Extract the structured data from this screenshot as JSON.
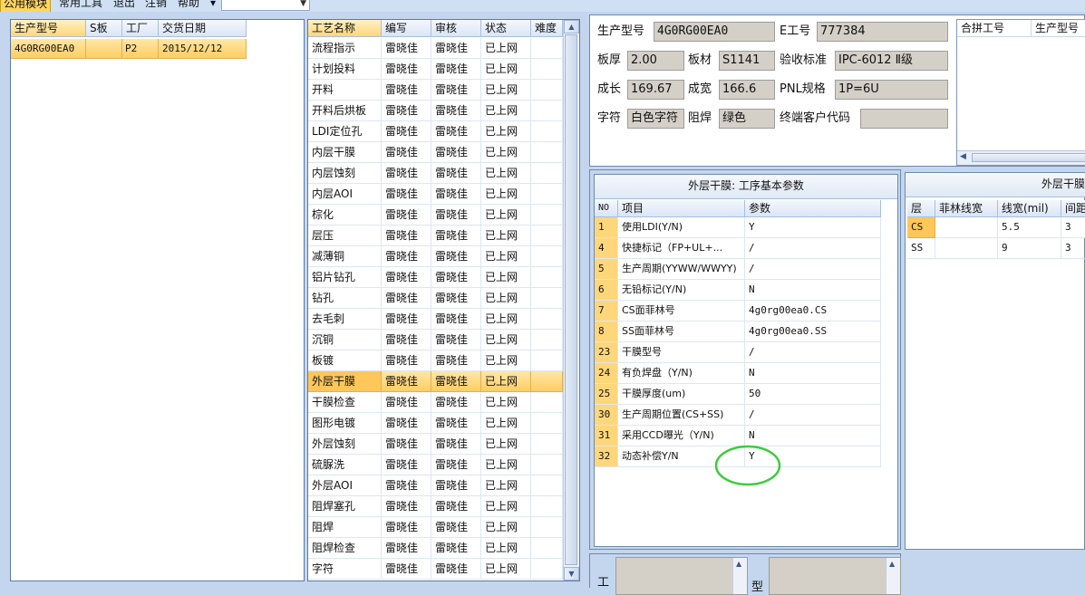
{
  "menu": {
    "items": [
      "公用模块",
      "常用工具",
      "退出",
      "注销",
      "帮助"
    ],
    "active_index": 0
  },
  "orders": {
    "columns": [
      "生产型号",
      "S板",
      "工厂",
      "交货日期"
    ],
    "rows": [
      {
        "model": "4G0RG00EA0",
        "s": "",
        "factory": "P2",
        "date": "2015/12/12"
      }
    ]
  },
  "process": {
    "columns": [
      "工艺名称",
      "编写",
      "审核",
      "状态",
      "难度"
    ],
    "selected_index": 17,
    "rows": [
      {
        "name": "流程指示",
        "writer": "雷晓佳",
        "reviewer": "雷晓佳",
        "status": "已上网"
      },
      {
        "name": "计划投料",
        "writer": "雷晓佳",
        "reviewer": "雷晓佳",
        "status": "已上网"
      },
      {
        "name": "开料",
        "writer": "雷晓佳",
        "reviewer": "雷晓佳",
        "status": "已上网"
      },
      {
        "name": "开料后烘板",
        "writer": "雷晓佳",
        "reviewer": "雷晓佳",
        "status": "已上网"
      },
      {
        "name": "LDI定位孔",
        "writer": "雷晓佳",
        "reviewer": "雷晓佳",
        "status": "已上网"
      },
      {
        "name": "内层干膜",
        "writer": "雷晓佳",
        "reviewer": "雷晓佳",
        "status": "已上网"
      },
      {
        "name": "内层蚀刻",
        "writer": "雷晓佳",
        "reviewer": "雷晓佳",
        "status": "已上网"
      },
      {
        "name": "内层AOI",
        "writer": "雷晓佳",
        "reviewer": "雷晓佳",
        "status": "已上网"
      },
      {
        "name": "棕化",
        "writer": "雷晓佳",
        "reviewer": "雷晓佳",
        "status": "已上网"
      },
      {
        "name": "层压",
        "writer": "雷晓佳",
        "reviewer": "雷晓佳",
        "status": "已上网"
      },
      {
        "name": "减薄铜",
        "writer": "雷晓佳",
        "reviewer": "雷晓佳",
        "status": "已上网"
      },
      {
        "name": "铝片钻孔",
        "writer": "雷晓佳",
        "reviewer": "雷晓佳",
        "status": "已上网"
      },
      {
        "name": "钻孔",
        "writer": "雷晓佳",
        "reviewer": "雷晓佳",
        "status": "已上网"
      },
      {
        "name": "去毛刺",
        "writer": "雷晓佳",
        "reviewer": "雷晓佳",
        "status": "已上网"
      },
      {
        "name": "沉铜",
        "writer": "雷晓佳",
        "reviewer": "雷晓佳",
        "status": "已上网"
      },
      {
        "name": "板镀",
        "writer": "雷晓佳",
        "reviewer": "雷晓佳",
        "status": "已上网"
      },
      {
        "name": "外层干膜",
        "writer": "雷晓佳",
        "reviewer": "雷晓佳",
        "status": "已上网"
      },
      {
        "name": "干膜检查",
        "writer": "雷晓佳",
        "reviewer": "雷晓佳",
        "status": "已上网"
      },
      {
        "name": "图形电镀",
        "writer": "雷晓佳",
        "reviewer": "雷晓佳",
        "status": "已上网"
      },
      {
        "name": "外层蚀刻",
        "writer": "雷晓佳",
        "reviewer": "雷晓佳",
        "status": "已上网"
      },
      {
        "name": "硫脲洗",
        "writer": "雷晓佳",
        "reviewer": "雷晓佳",
        "status": "已上网"
      },
      {
        "name": "外层AOI",
        "writer": "雷晓佳",
        "reviewer": "雷晓佳",
        "status": "已上网"
      },
      {
        "name": "阻焊塞孔",
        "writer": "雷晓佳",
        "reviewer": "雷晓佳",
        "status": "已上网"
      },
      {
        "name": "阻焊",
        "writer": "雷晓佳",
        "reviewer": "雷晓佳",
        "status": "已上网"
      },
      {
        "name": "阻焊检查",
        "writer": "雷晓佳",
        "reviewer": "雷晓佳",
        "status": "已上网"
      },
      {
        "name": "字符",
        "writer": "雷晓佳",
        "reviewer": "雷晓佳",
        "status": "已上网"
      }
    ]
  },
  "info": {
    "model_label": "生产型号",
    "model_value": "4G0RG00EA0",
    "eno_label": "E工号",
    "eno_value": "777384",
    "thickness_label": "板厚",
    "thickness_value": "2.00",
    "material_label": "板材",
    "material_value": "S1141",
    "standard_label": "验收标准",
    "standard_value": "IPC-6012 Ⅱ级",
    "length_label": "成长",
    "length_value": "169.67",
    "width_label": "成宽",
    "width_value": "166.6",
    "pnl_label": "PNL规格",
    "pnl_value": "1P=6U",
    "char_label": "字符",
    "char_value": "白色字符",
    "mask_label": "阻焊",
    "mask_value": "绿色",
    "customer_label": "终端客户代码",
    "customer_value": ""
  },
  "combined": {
    "columns": [
      "合拼工号",
      "生产型号"
    ]
  },
  "params": {
    "title": "外层干膜: 工序基本参数",
    "columns": [
      "NO",
      "项目",
      "参数"
    ],
    "rows": [
      {
        "no": "1",
        "item": "使用LDI(Y/N)",
        "value": "Y"
      },
      {
        "no": "4",
        "item": "快捷标记（FP+UL+...",
        "value": "/"
      },
      {
        "no": "5",
        "item": "生产周期(YYWW/WWYY)",
        "value": "/"
      },
      {
        "no": "6",
        "item": "无铅标记(Y/N)",
        "value": "N"
      },
      {
        "no": "7",
        "item": "CS面菲林号",
        "value": "4g0rg00ea0.CS"
      },
      {
        "no": "8",
        "item": "SS面菲林号",
        "value": "4g0rg00ea0.SS"
      },
      {
        "no": "23",
        "item": "干膜型号",
        "value": "/"
      },
      {
        "no": "24",
        "item": "有负焊盘（Y/N)",
        "value": "N"
      },
      {
        "no": "25",
        "item": "干膜厚度(um)",
        "value": "50"
      },
      {
        "no": "30",
        "item": "生产周期位置(CS+SS)",
        "value": "/"
      },
      {
        "no": "31",
        "item": "采用CCD曝光（Y/N)",
        "value": "N"
      },
      {
        "no": "32",
        "item": "动态补偿Y/N",
        "value": "Y"
      }
    ]
  },
  "layers": {
    "title": "外层干膜",
    "columns": [
      "层",
      "菲林线宽",
      "线宽(mil)",
      "间距"
    ],
    "rows": [
      {
        "layer": "CS",
        "film": "",
        "width": "5.5",
        "gap": "3"
      },
      {
        "layer": "SS",
        "film": "",
        "width": "9",
        "gap": "3"
      }
    ]
  },
  "bottom": {
    "label1": "工",
    "label2": "型"
  },
  "colors": {
    "selection": "#ffcd63",
    "highlight_ellipse": "#3ccc3c",
    "form_box": "#d4d0c8"
  }
}
